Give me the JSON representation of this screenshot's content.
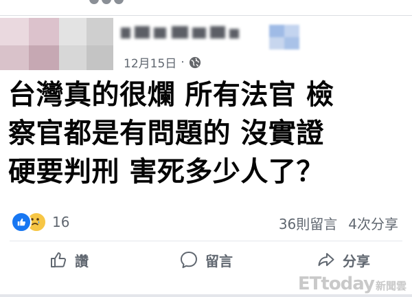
{
  "post": {
    "date": "12月15日",
    "dot": "·",
    "text": "台灣真的很爛 所有法官 檢\n察官都是有問題的 沒實證\n硬要判刑 害死多少人了？"
  },
  "reactions": {
    "count": "16",
    "types": [
      "like",
      "sad"
    ]
  },
  "stats": {
    "comments": "36則留言",
    "shares": "4次分享"
  },
  "actions": {
    "like": "讚",
    "comment": "留言",
    "share": "分享"
  },
  "watermark": {
    "brand": "ETtoday",
    "sub": "新聞雲"
  },
  "colors": {
    "like_blue": "#1877f2",
    "sad_yellow": "#f7c645",
    "meta_gray": "#606770"
  },
  "icons": [
    "globe-icon",
    "like-reaction-icon",
    "sad-reaction-icon",
    "thumbs-up-icon",
    "comment-bubble-icon",
    "share-arrow-icon"
  ]
}
